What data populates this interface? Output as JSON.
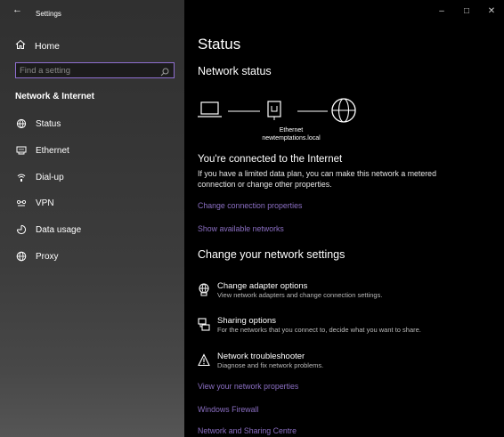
{
  "window": {
    "title": "Settings",
    "back_glyph": "←",
    "controls": {
      "minimize": "–",
      "maximize": "□",
      "close": "✕"
    }
  },
  "sidebar": {
    "home_label": "Home",
    "search_placeholder": "Find a setting",
    "section_heading": "Network & Internet",
    "items": [
      {
        "label": "Status",
        "icon": "status-icon"
      },
      {
        "label": "Ethernet",
        "icon": "ethernet-icon"
      },
      {
        "label": "Dial-up",
        "icon": "dialup-icon"
      },
      {
        "label": "VPN",
        "icon": "vpn-icon"
      },
      {
        "label": "Data usage",
        "icon": "data-usage-icon"
      },
      {
        "label": "Proxy",
        "icon": "globe-icon"
      }
    ]
  },
  "main": {
    "title": "Status",
    "network_status_heading": "Network status",
    "diagram": {
      "adapter_label": "Ethernet",
      "network_name": "newtemptations.local"
    },
    "connected_title": "You're connected to the Internet",
    "connected_desc": "If you have a limited data plan, you can make this network a metered connection or change other properties.",
    "links_top": [
      "Change connection properties",
      "Show available networks"
    ],
    "change_heading": "Change your network settings",
    "settings": [
      {
        "title": "Change adapter options",
        "desc": "View network adapters and change connection settings.",
        "icon": "adapter-icon"
      },
      {
        "title": "Sharing options",
        "desc": "For the networks that you connect to, decide what you want to share.",
        "icon": "sharing-icon"
      },
      {
        "title": "Network troubleshooter",
        "desc": "Diagnose and fix network problems.",
        "icon": "warning-icon"
      }
    ],
    "links_bottom": [
      "View your network properties",
      "Windows Firewall",
      "Network and Sharing Centre"
    ]
  },
  "colors": {
    "accent": "#8a6ec2",
    "search_border": "#8f6fd0",
    "background": "#000000"
  }
}
